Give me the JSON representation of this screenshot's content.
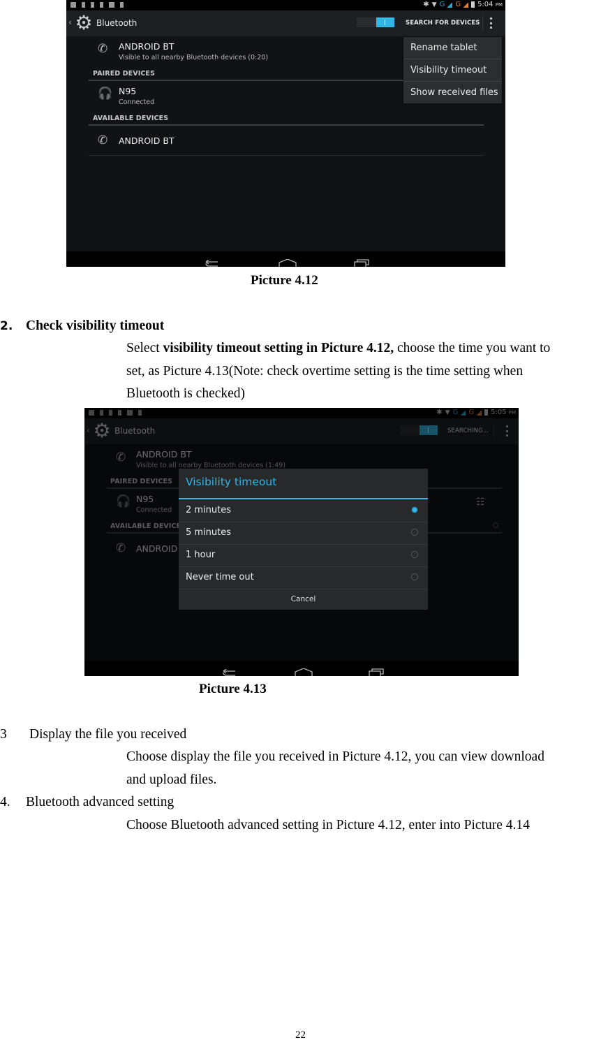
{
  "picture_412": {
    "status_time": "5:04",
    "status_ampm": "PM",
    "app_title": "Bluetooth",
    "search_button": "SEARCH FOR DEVICES",
    "this_device": {
      "name": "ANDROID BT",
      "subtitle": "Visible to all nearby Bluetooth devices (0:20)"
    },
    "paired_header": "PAIRED DEVICES",
    "paired": [
      {
        "name": "N95",
        "status": "Connected",
        "icon": "headset-icon"
      }
    ],
    "available_header": "AVAILABLE DEVICES",
    "available": [
      {
        "name": "ANDROID BT",
        "icon": "phone-icon"
      }
    ],
    "overflow_menu": [
      "Rename tablet",
      "Visibility timeout",
      "Show received files"
    ],
    "caption": "Picture 4.12"
  },
  "section2": {
    "number": "2.",
    "title": "Check visibility timeout",
    "body_pre": "Select ",
    "body_bold": "visibility timeout setting in Picture 4.12,",
    "body_line1_rest": " choose the time you want to",
    "body_line2": "set, as Picture 4.13(Note: check overtime setting is the time setting when",
    "body_line3": "Bluetooth is checked)"
  },
  "picture_413": {
    "status_time": "5:05",
    "status_ampm": "PM",
    "app_title": "Bluetooth",
    "search_button": "SEARCHING...",
    "this_device": {
      "name": "ANDROID BT",
      "subtitle": "Visible to all nearby Bluetooth devices (1:49)"
    },
    "paired_header": "PAIRED DEVICES",
    "paired": [
      {
        "name": "N95",
        "status": "Connected",
        "icon": "headset-icon"
      }
    ],
    "available_header": "AVAILABLE DEVICES",
    "available": [
      {
        "name": "ANDROID BT",
        "icon": "phone-icon"
      }
    ],
    "dialog": {
      "title": "Visibility timeout",
      "options": [
        {
          "label": "2 minutes",
          "selected": true
        },
        {
          "label": "5 minutes",
          "selected": false
        },
        {
          "label": "1 hour",
          "selected": false
        },
        {
          "label": "Never time out",
          "selected": false
        }
      ],
      "cancel": "Cancel"
    },
    "caption": "Picture 4.13"
  },
  "section3": {
    "number": "3",
    "title": "Display the file you received",
    "body_line1": "Choose display the file you received in Picture 4.12, you can view download",
    "body_line2": "and upload files."
  },
  "section4": {
    "number": "4.",
    "title": "Bluetooth advanced setting",
    "body_line1": "Choose Bluetooth advanced setting in Picture 4.12, enter into Picture 4.14"
  },
  "page_number": "22",
  "colors": {
    "accent": "#33b5e5",
    "screen_bg": "#101214",
    "actionbar_bg": "#1d2023"
  }
}
